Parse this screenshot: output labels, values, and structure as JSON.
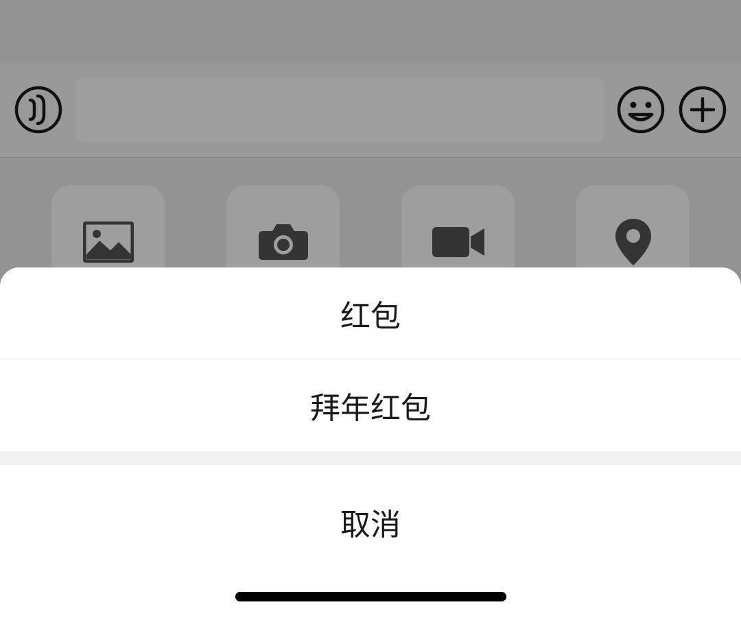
{
  "inputBar": {
    "voiceIcon": "voice",
    "emojiIcon": "emoji",
    "plusIcon": "plus",
    "placeholder": ""
  },
  "attachments": {
    "photo": "photo",
    "camera": "camera",
    "video": "video",
    "location": "location"
  },
  "actionSheet": {
    "option1": "红包",
    "option2": "拜年红包",
    "cancel": "取消"
  }
}
